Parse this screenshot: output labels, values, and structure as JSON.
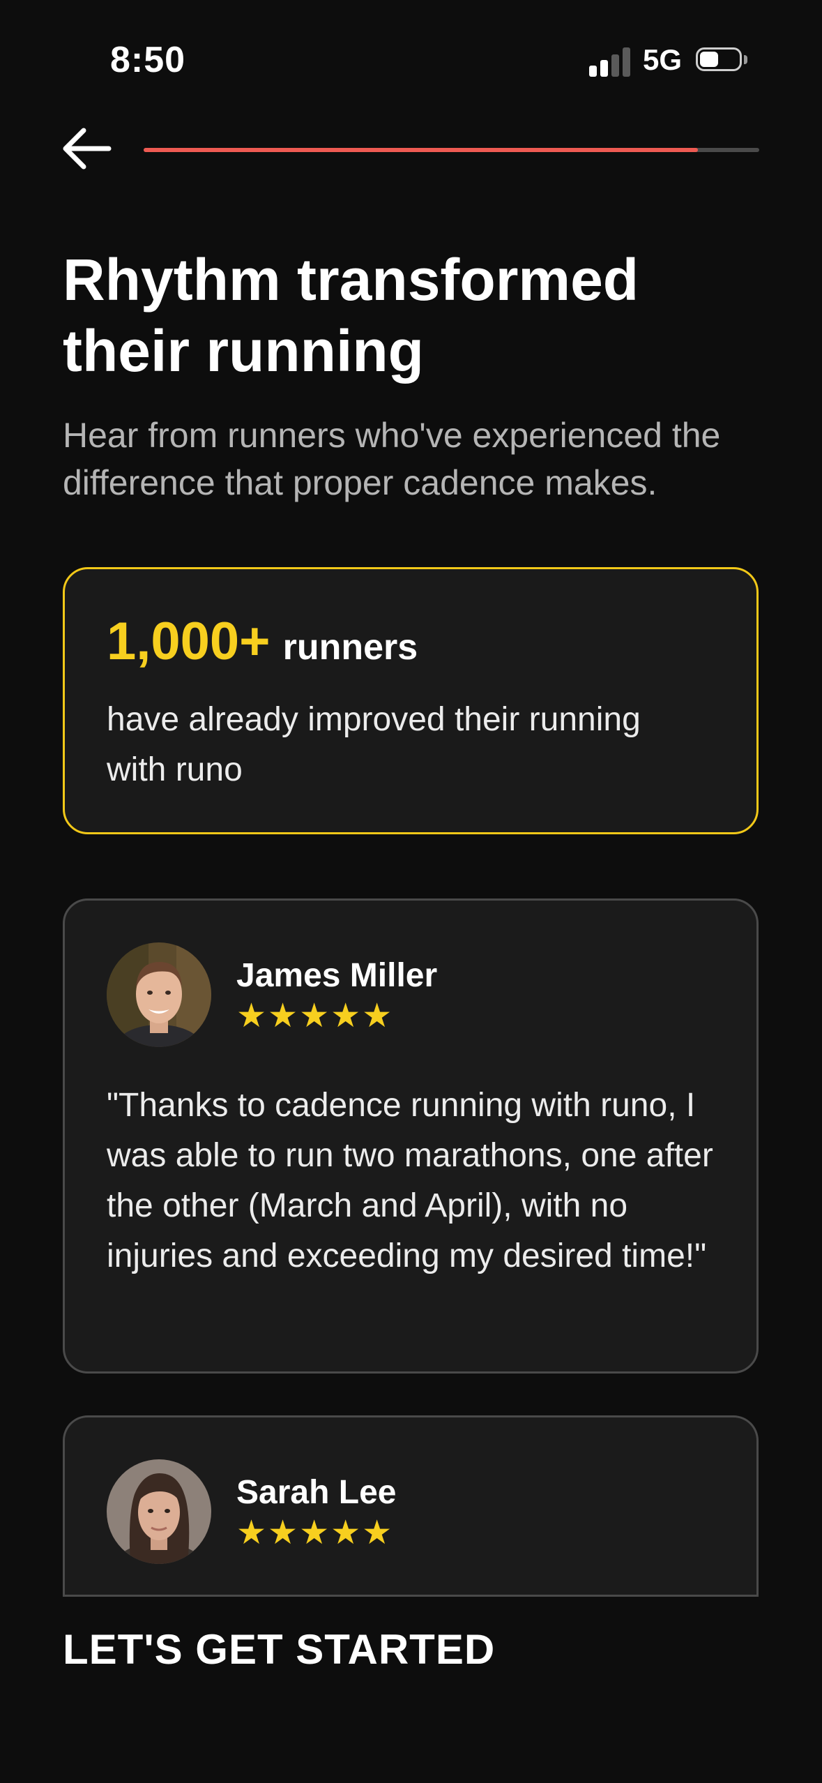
{
  "status_bar": {
    "time": "8:50",
    "network": "5G",
    "signal_bars_active": 2,
    "signal_bars_total": 4
  },
  "progress": {
    "value": 0.9,
    "fill_color": "#ee5a52",
    "track_color": "#4a4a4a"
  },
  "header": {
    "title": "Rhythm transformed their running",
    "subtitle": "Hear from runners who've experienced the difference that proper cadence makes."
  },
  "stats": {
    "number": "1,000+",
    "unit": "runners",
    "description": "have already improved their running with runo",
    "accent_color": "#f7cf1f"
  },
  "testimonials": [
    {
      "name": "James Miller",
      "rating": 5,
      "stars": "★★★★★",
      "quote": "\"Thanks to cadence running with runo, I was able to run two marathons, one after the other (March and April), with no injuries and exceeding my desired time!\""
    },
    {
      "name": "Sarah Lee",
      "rating": 5,
      "stars": "★★★★★"
    }
  ],
  "cta": {
    "label": "LET'S GET STARTED"
  }
}
